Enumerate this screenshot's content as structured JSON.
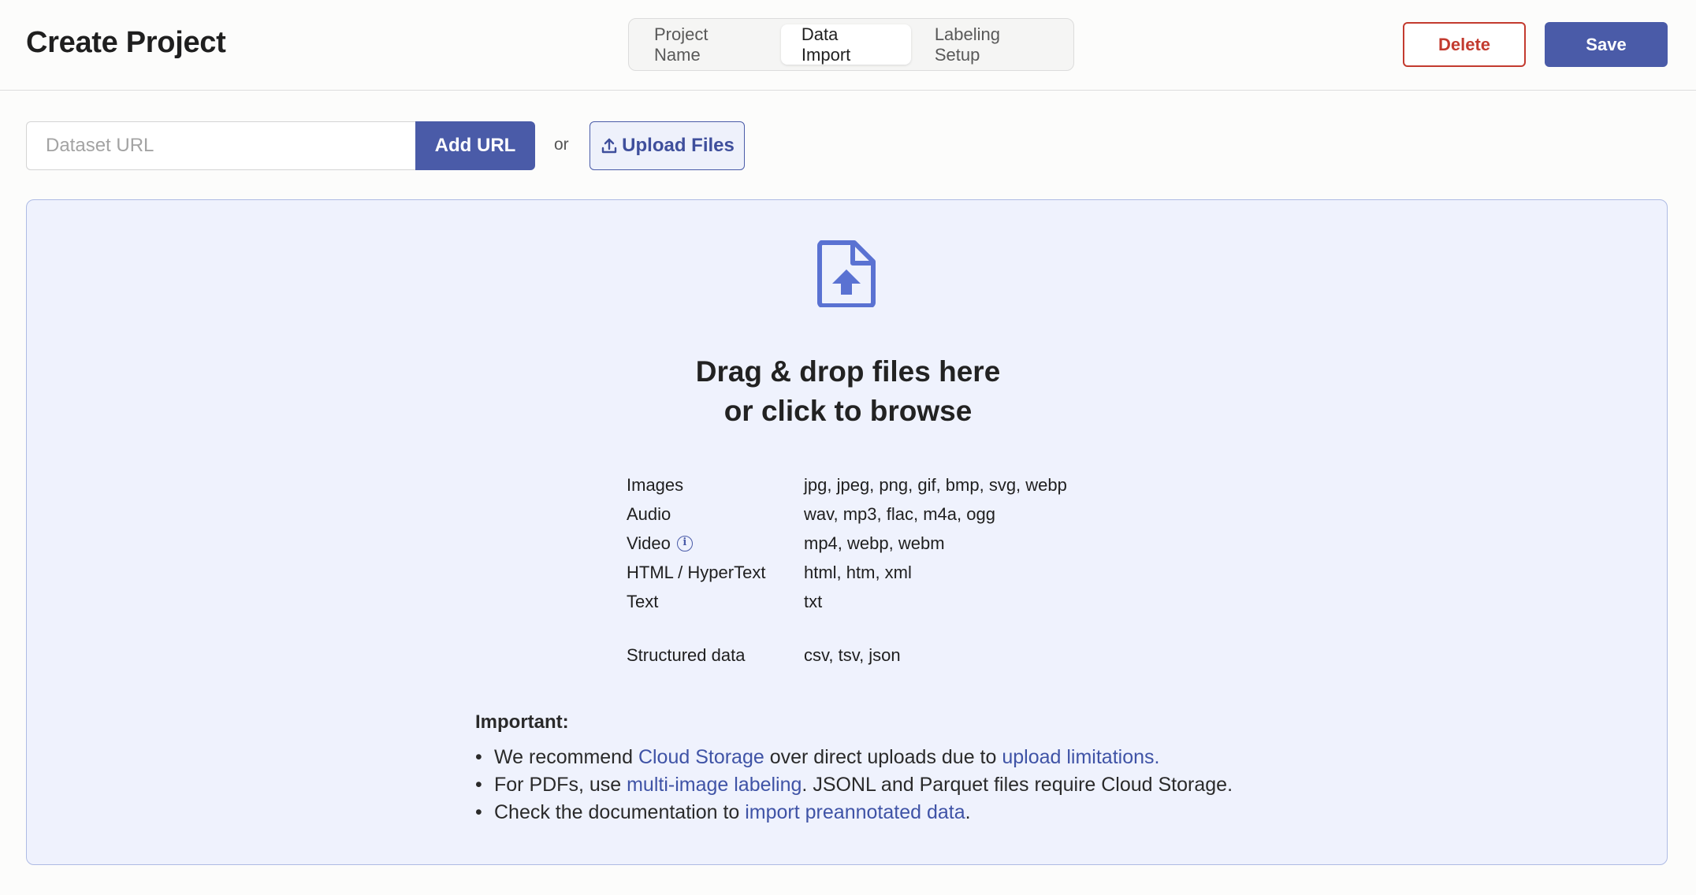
{
  "header": {
    "title": "Create Project",
    "tabs": [
      {
        "label": "Project Name",
        "active": false
      },
      {
        "label": "Data Import",
        "active": true
      },
      {
        "label": "Labeling Setup",
        "active": false
      }
    ],
    "delete_label": "Delete",
    "save_label": "Save"
  },
  "import_bar": {
    "url_placeholder": "Dataset URL",
    "url_value": "",
    "add_url_label": "Add URL",
    "or_text": "or",
    "upload_label": "Upload Files",
    "upload_icon": "upload-icon"
  },
  "dropzone": {
    "icon": "file-upload-icon",
    "title_line1": "Drag & drop files here",
    "title_line2": "or click to browse",
    "file_types": [
      {
        "name": "Images",
        "extensions": "jpg, jpeg, png, gif, bmp, svg, webp"
      },
      {
        "name": "Audio",
        "extensions": "wav, mp3, flac, m4a, ogg"
      },
      {
        "name": "Video",
        "extensions": "mp4, webp, webm",
        "info_icon": "i"
      },
      {
        "name": "HTML / HyperText",
        "extensions": "html, htm, xml"
      },
      {
        "name": "Text",
        "extensions": "txt"
      },
      {
        "name": "Structured data",
        "extensions": "csv, tsv, json"
      }
    ],
    "important_title": "Important:",
    "notes": [
      {
        "bullet": "•",
        "t1": "We recommend ",
        "link1": "Cloud Storage",
        "t2": " over direct uploads due to ",
        "link2": "upload limitations",
        "t3": "."
      },
      {
        "bullet": "•",
        "t1": "For PDFs, use ",
        "link1": "multi-image labeling",
        "t2": ". JSONL and Parquet files require Cloud Storage."
      },
      {
        "bullet": "•",
        "t1": "Check the documentation to ",
        "link1": "import preannotated data",
        "t2": "."
      }
    ]
  },
  "colors": {
    "accent": "#4a5ba8",
    "danger": "#c33b2f",
    "dropzone_bg": "#eff2fd",
    "link": "#3f53a6"
  }
}
